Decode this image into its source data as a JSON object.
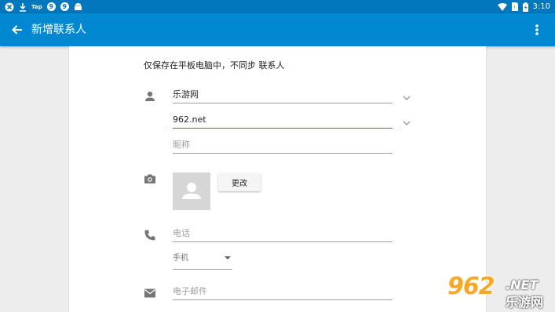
{
  "statusbar": {
    "icons_left": [
      "x-icon",
      "download-icon",
      "tap-icon",
      "app-9-icon",
      "app-9b-icon",
      "android-icon"
    ],
    "tap_label": "Tap",
    "nine_label": "9",
    "time": "3:10"
  },
  "appbar": {
    "title": "新增联系人"
  },
  "form": {
    "info": "仅保存在平板电脑中，不同步 联系人",
    "name_value": "乐游网",
    "org_value": "962.net",
    "nickname_placeholder": "昵称",
    "change_button": "更改",
    "phone_placeholder": "电话",
    "phone_type": "手机",
    "email_placeholder": "电子邮件"
  },
  "watermark": {
    "big": "962",
    "net": ".NET",
    "cn": "乐游网"
  },
  "colors": {
    "appbar": "#0288d1",
    "statusbar": "#0277bd",
    "accent": "#0288d1"
  }
}
